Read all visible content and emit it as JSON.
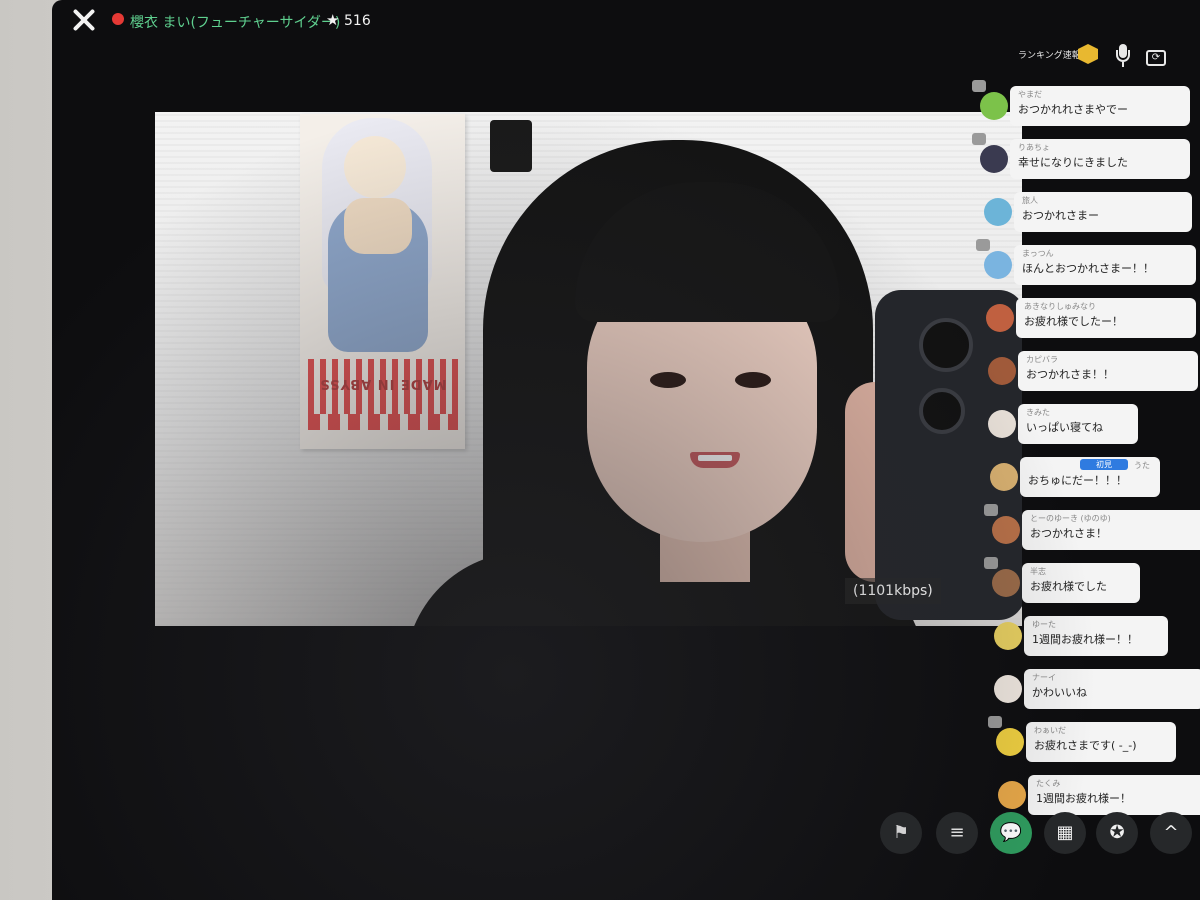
{
  "header": {
    "streamer_name": "櫻衣 まい(フューチャーサイダー)",
    "star_count": "516",
    "ranking_label": "ランキング速報"
  },
  "video": {
    "bitrate": "(1101kbps)",
    "poster_caption": "MADE IN ABYSS"
  },
  "chat": [
    {
      "user": "やまだ",
      "message": "おつかれれさまやでー",
      "avatar_color": "#7cc24a"
    },
    {
      "user": "りあちょ",
      "message": "幸せになりにきました",
      "avatar_color": "#3a3a50"
    },
    {
      "user": "旅人",
      "message": "おつかれさまー",
      "avatar_color": "#6cb4d8"
    },
    {
      "user": "まっつん",
      "message": "ほんとおつかれさまー！！",
      "avatar_color": "#7ab4e0"
    },
    {
      "user": "あきなりしゅみなり",
      "message": "お疲れ様でしたー！",
      "avatar_color": "#c06040"
    },
    {
      "user": "カピバラ",
      "message": "おつかれさま！！",
      "avatar_color": "#a05a3a"
    },
    {
      "user": "きみた",
      "message": "いっぱい寝てね",
      "avatar_color": "#e8e0d8"
    },
    {
      "user": "うた",
      "message": "おちゅにだー！！！",
      "avatar_color": "#d8b070",
      "first_time": "初見"
    },
    {
      "user": "とーのゆーき (ゆのゆ)",
      "message": "おつかれさま！",
      "avatar_color": "#b87048"
    },
    {
      "user": "半志",
      "message": "お疲れ様でした",
      "avatar_color": "#9a6a48"
    },
    {
      "user": "ゆーた",
      "message": "1週間お疲れ様ー！！",
      "avatar_color": "#e8d060"
    },
    {
      "user": "ナーイ",
      "message": "かわいいね",
      "avatar_color": "#f0e8e0"
    },
    {
      "user": "わぁいだ",
      "message": "お疲れさまです( -_-)",
      "avatar_color": "#f0d040"
    },
    {
      "user": "たくみ",
      "message": "1週間お疲れ様ー！",
      "avatar_color": "#e8a848"
    }
  ],
  "toolbar": {
    "flag": "⚑",
    "notes": "≡",
    "comment": "💬",
    "gift": "▦",
    "badge": "✪",
    "expand": "^"
  }
}
